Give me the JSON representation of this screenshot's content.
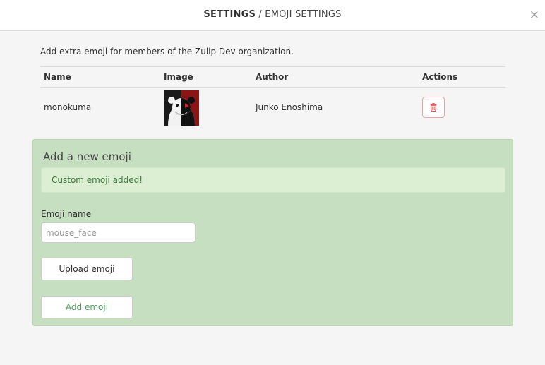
{
  "header": {
    "title": "SETTINGS",
    "separator": " / ",
    "subtitle": "EMOJI SETTINGS",
    "close_icon": "×"
  },
  "description": "Add extra emoji for members of the Zulip Dev organization.",
  "table": {
    "headers": [
      "Name",
      "Image",
      "Author",
      "Actions"
    ],
    "rows": [
      {
        "name": "monokuma",
        "image": "monokuma-emoji-image",
        "author": "Junko Enoshima",
        "action_icon": "trash-icon"
      }
    ]
  },
  "add_form": {
    "title": "Add a new emoji",
    "alert": "Custom emoji added!",
    "name_label": "Emoji name",
    "name_placeholder": "mouse_face",
    "name_value": "",
    "upload_label": "Upload emoji",
    "submit_label": "Add emoji"
  },
  "colors": {
    "form_bg": "#c5dfc0",
    "alert_bg": "#dcefd2",
    "alert_text": "#3c763d",
    "delete_red": "#d9534f",
    "submit_text": "#4a9d5b"
  }
}
